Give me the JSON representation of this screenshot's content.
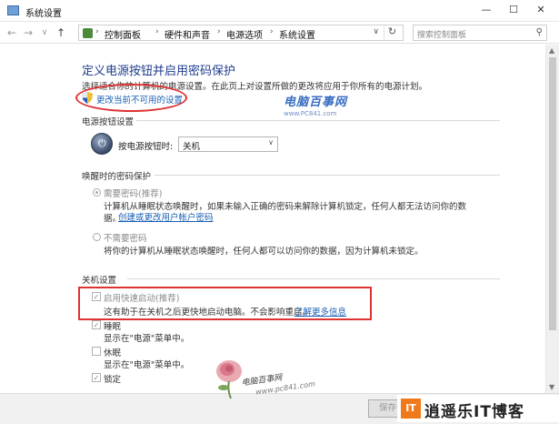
{
  "window": {
    "title": "系统设置",
    "controls": {
      "minimize": "—",
      "maximize": "☐",
      "close": "✕"
    }
  },
  "nav": {
    "back": "←",
    "forward": "→",
    "dropdown": "∨",
    "up": "↑",
    "breadcrumb": [
      "控制面板",
      "硬件和声音",
      "电源选项",
      "系统设置"
    ],
    "separator": "›",
    "refresh": "↻",
    "search_placeholder": "搜索控制面板"
  },
  "page": {
    "title": "定义电源按钮并启用密码保护",
    "description": "选择适合你的计算机的电源设置。在此页上对设置所做的更改将应用于你所有的电源计划。",
    "change_link": "更改当前不可用的设置"
  },
  "power_button": {
    "section_title": "电源按钮设置",
    "label": "按电源按钮时:",
    "selected": "关机"
  },
  "wake_password": {
    "section_title": "唤醒时的密码保护",
    "require_label": "需要密码(推荐)",
    "require_desc_1": "计算机从睡眠状态唤醒时，如果未输入正确的密码来解除计算机锁定，任何人都无法访问你的数",
    "require_desc_2": "据。",
    "require_link": "创建或更改用户帐户密码",
    "no_require_label": "不需要密码",
    "no_require_desc": "将你的计算机从睡眠状态唤醒时，任何人都可以访问你的数据，因为计算机未锁定。"
  },
  "shutdown": {
    "section_title": "关机设置",
    "fast_startup_label": "启用快速启动(推荐)",
    "fast_startup_desc": "这有助于在关机之后更快地启动电脑。不会影响重启。",
    "fast_startup_link": "了解更多信息",
    "sleep_label": "睡眠",
    "sleep_desc": "显示在\"电源\"菜单中。",
    "hibernate_label": "休眠",
    "hibernate_desc": "显示在\"电源\"菜单中。",
    "lock_label": "锁定"
  },
  "buttons": {
    "save": "保存修改",
    "cancel": "取消"
  },
  "watermarks": {
    "top_name": "电脑百事网",
    "top_url": "www.PC841.com",
    "bottom_name": "电脑百事网",
    "bottom_url": "www.pc841.com",
    "brand_logo": "IT",
    "brand_name": "逍遥乐IT博客"
  },
  "colors": {
    "title_blue": "#1e3d8c",
    "link_blue": "#1a5fb4",
    "highlight_red": "#d33",
    "brand_orange": "#f07a1a"
  }
}
